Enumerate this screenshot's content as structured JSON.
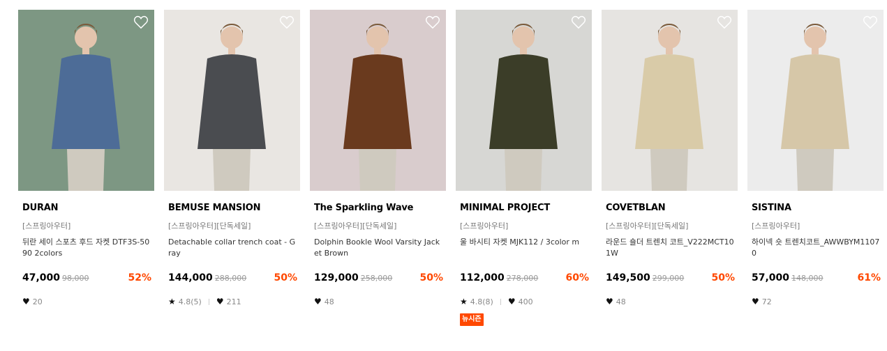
{
  "products": [
    {
      "brand": "DURAN",
      "category": "[스프링아우터]",
      "name": "뒤란 세이 스포츠 후드 자켓 DTF3S-5090 2colors",
      "price": "47,000",
      "original_price": "98,000",
      "discount": "52%",
      "rating": "",
      "likes": "20",
      "badge": "",
      "bg": "#7d9783",
      "garment": "#4d6c97"
    },
    {
      "brand": "BEMUSE MANSION",
      "category": "[스프링아우터][단독세일]",
      "name": "Detachable collar trench coat - Gray",
      "price": "144,000",
      "original_price": "288,000",
      "discount": "50%",
      "rating": "4.8(5)",
      "likes": "211",
      "badge": "",
      "bg": "#e9e6e2",
      "garment": "#4a4c50"
    },
    {
      "brand": "The Sparkling Wave",
      "category": "[스프링아우터][단독세일]",
      "name": "Dolphin Bookle Wool Varsity Jacket Brown",
      "price": "129,000",
      "original_price": "258,000",
      "discount": "50%",
      "rating": "",
      "likes": "48",
      "badge": "",
      "bg": "#d9cccd",
      "garment": "#6a3a1e"
    },
    {
      "brand": "MINIMAL PROJECT",
      "category": "[스프링아우터]",
      "name": "울 바시티 자켓 MJK112 / 3color m",
      "price": "112,000",
      "original_price": "278,000",
      "discount": "60%",
      "rating": "4.8(8)",
      "likes": "400",
      "badge": "뉴시즌",
      "bg": "#d7d7d4",
      "garment": "#3b3d28"
    },
    {
      "brand": "COVETBLAN",
      "category": "[스프링아우터][단독세일]",
      "name": "라운드 숄더 트렌치 코트_V222MCT101W",
      "price": "149,500",
      "original_price": "299,000",
      "discount": "50%",
      "rating": "",
      "likes": "48",
      "badge": "",
      "bg": "#e6e4e1",
      "garment": "#d9cba8"
    },
    {
      "brand": "SISTINA",
      "category": "[스프링아우터]",
      "name": "하이넥 숏 트렌치코트_AWWBYM11070",
      "price": "57,000",
      "original_price": "148,000",
      "discount": "61%",
      "rating": "",
      "likes": "72",
      "badge": "",
      "bg": "#ececec",
      "garment": "#d6c7a8"
    }
  ],
  "colors": {
    "discount": "#ff4800",
    "badge_bg": "#ff4800"
  },
  "icons": {
    "wish": "heart-outline-icon",
    "likes": "heart-filled-icon",
    "rating": "star-icon"
  }
}
